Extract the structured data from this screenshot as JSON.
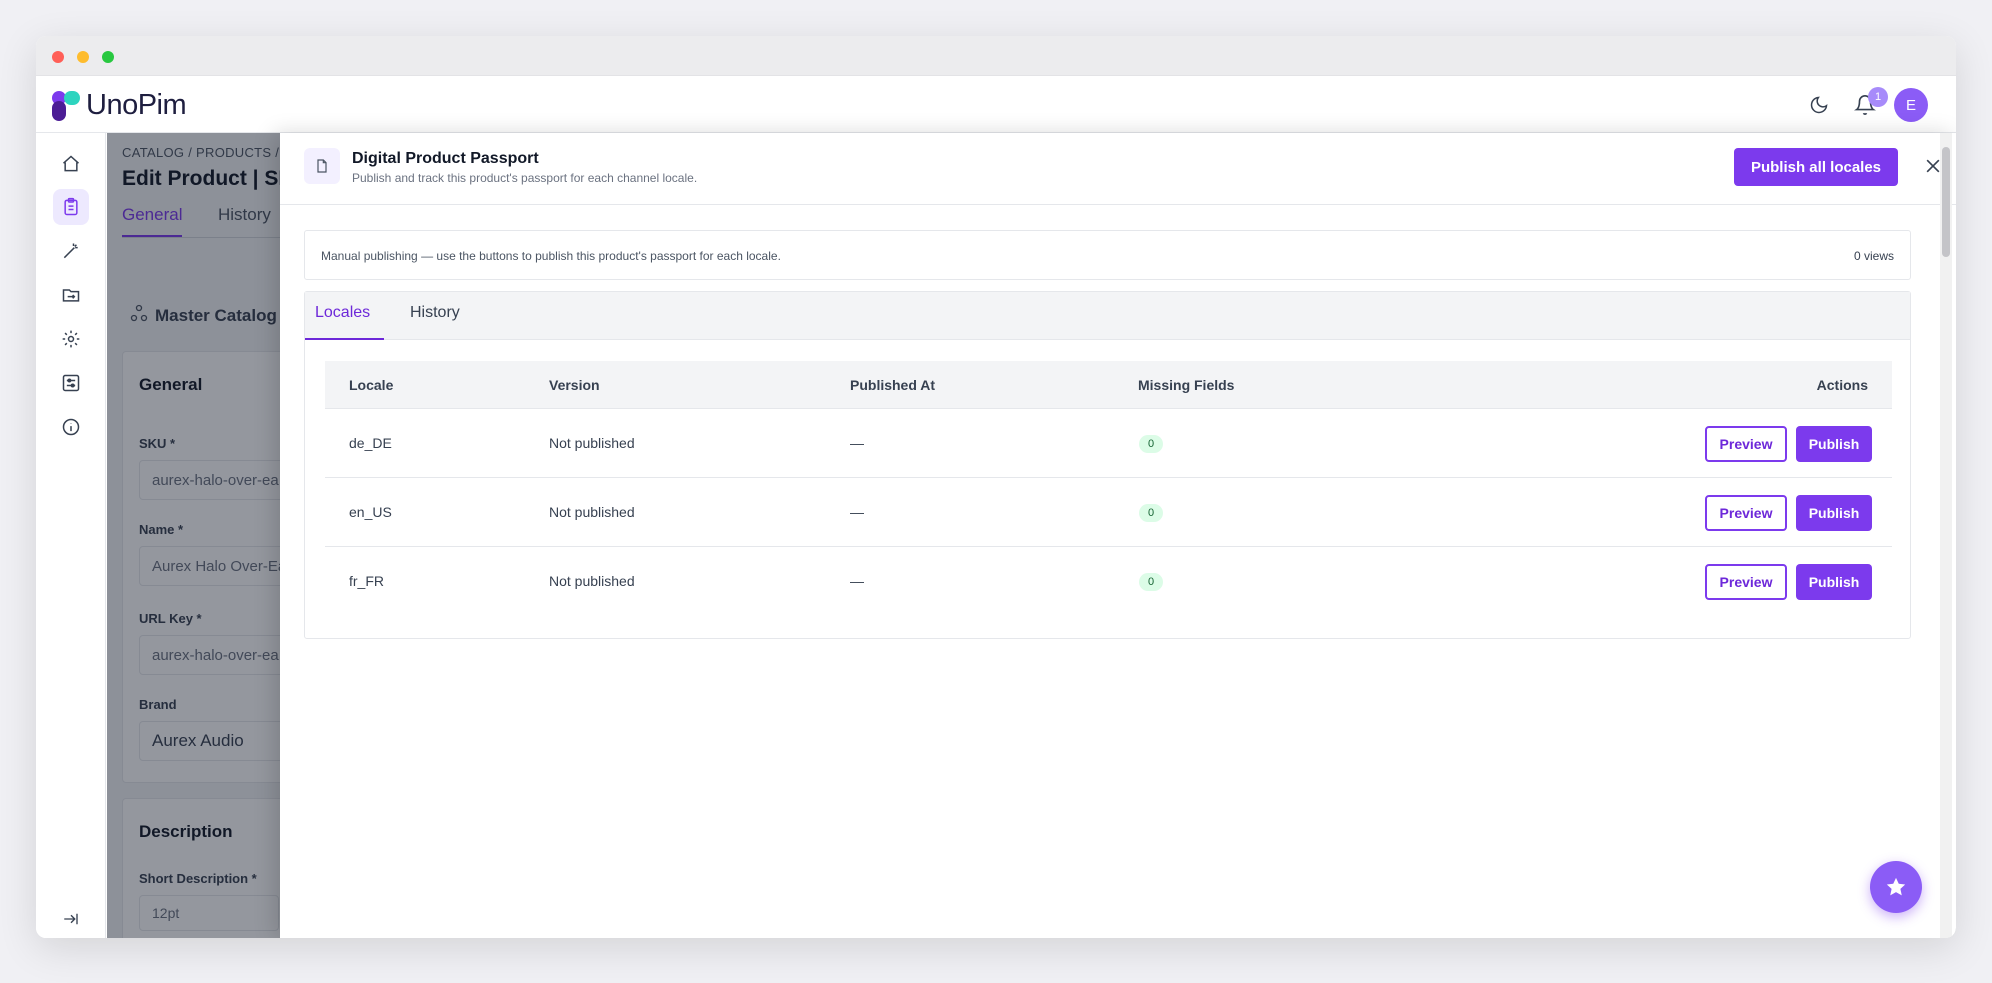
{
  "app": {
    "logo_text": "UnoPim",
    "notification_count": "1",
    "avatar_initial": "E"
  },
  "backdrop": {
    "breadcrumb": "CATALOG  /  PRODUCTS  /",
    "title": "Edit Product | SK",
    "tabs": [
      "General",
      "History"
    ],
    "master_catalog": "Master Catalog",
    "general_card": {
      "title": "General",
      "fields": [
        {
          "label": "SKU *",
          "value": "aurex-halo-over-ea"
        },
        {
          "label": "Name *",
          "value": "Aurex Halo Over-Ea"
        },
        {
          "label": "URL Key *",
          "value": "aurex-halo-over-ea"
        },
        {
          "label": "Brand",
          "value": "Aurex Audio"
        }
      ]
    },
    "description_card": {
      "title": "Description",
      "field_label": "Short Description *",
      "font_size_value": "12pt"
    }
  },
  "panel": {
    "title": "Digital Product Passport",
    "subtitle": "Publish and track this product's passport for each channel locale.",
    "publish_all_label": "Publish all locales",
    "info_text": "Manual publishing — use the buttons to publish this product's passport for each locale.",
    "views": "0 views",
    "tabs": [
      "Locales",
      "History"
    ],
    "columns": [
      "Locale",
      "Version",
      "Published At",
      "Missing Fields",
      "Actions"
    ],
    "rows": [
      {
        "locale": "de_DE",
        "version": "Not published",
        "published_at": "—",
        "missing": "0",
        "preview": "Preview",
        "publish": "Publish"
      },
      {
        "locale": "en_US",
        "version": "Not published",
        "published_at": "—",
        "missing": "0",
        "preview": "Preview",
        "publish": "Publish"
      },
      {
        "locale": "fr_FR",
        "version": "Not published",
        "published_at": "—",
        "missing": "0",
        "preview": "Preview",
        "publish": "Publish"
      }
    ]
  },
  "colors": {
    "accent": "#7c3aed",
    "badge_bg": "#dcfce7",
    "badge_text": "#166534"
  }
}
